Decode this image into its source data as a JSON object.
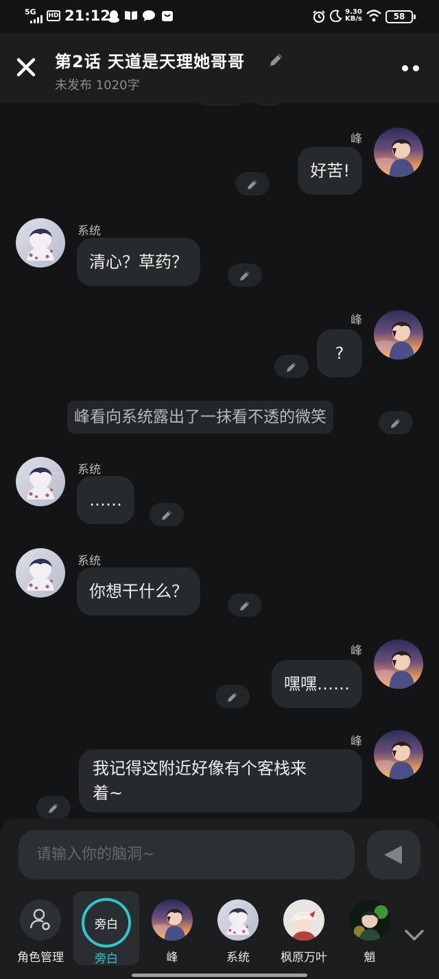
{
  "status_bar": {
    "network": "5G",
    "hd": "HD",
    "time": "21:12",
    "speed_value": "9.30",
    "speed_unit": "KB/s",
    "battery": "58"
  },
  "header": {
    "title": "第2话   天道是天理她哥哥",
    "subtitle": "未发布 1020字"
  },
  "messages": [
    {
      "side": "right",
      "name": "峰",
      "text": "好苦!"
    },
    {
      "side": "left",
      "name": "系统",
      "text": "清心？草药？"
    },
    {
      "side": "right",
      "name": "峰",
      "text": "?"
    },
    {
      "side": "narration",
      "text": "峰看向系统露出了一抹看不透的微笑"
    },
    {
      "side": "left",
      "name": "系统",
      "text": "……"
    },
    {
      "side": "left",
      "name": "系统",
      "text": "你想干什么？"
    },
    {
      "side": "right",
      "name": "峰",
      "text": "嘿嘿……"
    },
    {
      "side": "right",
      "name": "峰",
      "text": "我记得这附近好像有个客栈来\n着~"
    }
  ],
  "composer": {
    "placeholder": "请输入你的脑洞~"
  },
  "characters": [
    {
      "label": "角色管理",
      "icon": "person-gear-icon"
    },
    {
      "label": "旁白",
      "inner": "旁白",
      "selected": true
    },
    {
      "label": "峰"
    },
    {
      "label": "系统"
    },
    {
      "label": "枫原万叶"
    },
    {
      "label": "魈"
    }
  ],
  "colors": {
    "accent": "#31c6cf",
    "background": "#121415",
    "bubble": "#262a2d"
  }
}
